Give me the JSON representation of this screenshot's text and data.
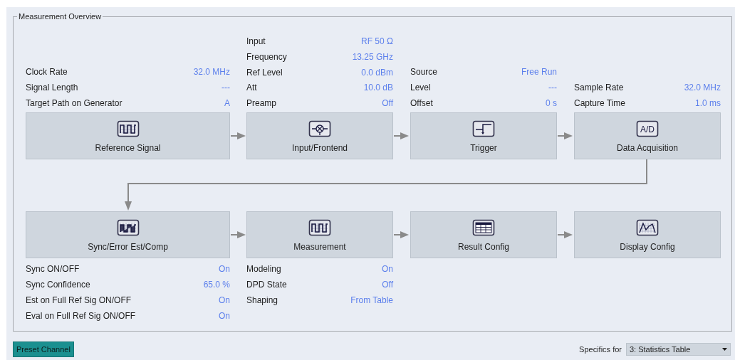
{
  "panel": {
    "title": "Measurement Overview"
  },
  "rows": [
    {
      "blocks": [
        {
          "label": "Reference Signal",
          "params": [
            {
              "name": "Clock Rate",
              "value": "32.0 MHz"
            },
            {
              "name": "Signal Length",
              "value": "---"
            },
            {
              "name": "Target Path on Generator",
              "value": "A"
            }
          ]
        },
        {
          "label": "Input/Frontend",
          "params": [
            {
              "name": "Input",
              "value": "RF 50 Ω"
            },
            {
              "name": "Frequency",
              "value": "13.25 GHz"
            },
            {
              "name": "Ref Level",
              "value": "0.0 dBm"
            },
            {
              "name": "Att",
              "value": "10.0 dB"
            },
            {
              "name": "Preamp",
              "value": "Off"
            }
          ]
        },
        {
          "label": "Trigger",
          "params": [
            {
              "name": "Source",
              "value": "Free Run"
            },
            {
              "name": "Level",
              "value": "---"
            },
            {
              "name": "Offset",
              "value": "0 s"
            }
          ]
        },
        {
          "label": "Data Acquisition",
          "icon_text": "A/D",
          "params": [
            {
              "name": "Sample Rate",
              "value": "32.0 MHz"
            },
            {
              "name": "Capture Time",
              "value": "1.0 ms"
            }
          ]
        }
      ]
    },
    {
      "blocks": [
        {
          "label": "Sync/Error Est/Comp",
          "params": [
            {
              "name": "Sync ON/OFF",
              "value": "On"
            },
            {
              "name": "Sync Confidence",
              "value": "65.0 %"
            },
            {
              "name": "Est on Full Ref Sig ON/OFF",
              "value": "On"
            },
            {
              "name": "Eval on Full Ref Sig ON/OFF",
              "value": "On"
            }
          ]
        },
        {
          "label": "Measurement",
          "params": [
            {
              "name": "Modeling",
              "value": "On"
            },
            {
              "name": "DPD State",
              "value": "Off"
            },
            {
              "name": "Shaping",
              "value": "From Table"
            }
          ]
        },
        {
          "label": "Result Config"
        },
        {
          "label": "Display Config"
        }
      ]
    }
  ],
  "preset_button": "Preset Channel",
  "specifics": {
    "label": "Specifics for",
    "value": "3: Statistics Table"
  }
}
